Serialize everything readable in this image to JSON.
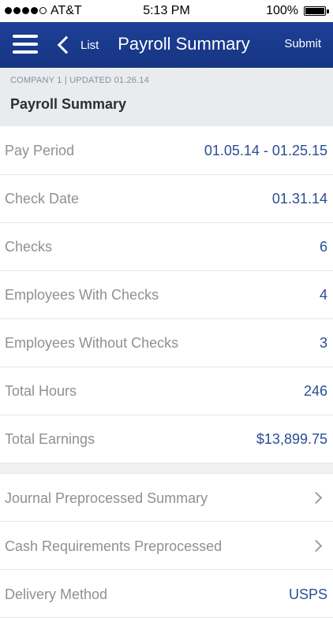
{
  "status_bar": {
    "carrier": "AT&T",
    "time": "5:13 PM",
    "battery": "100%",
    "battery_level": 1.0,
    "signal_bars": 4
  },
  "nav_bar": {
    "back_label": "List",
    "title": "Payroll Summary",
    "submit_label": "Submit",
    "color": "#1d3f96"
  },
  "header": {
    "company_line": "COMPANY 1 | UPDATED 01.26.14",
    "section_title": "Payroll Summary"
  },
  "summary": [
    {
      "label": "Pay Period",
      "value": "01.05.14 - 01.25.15"
    },
    {
      "label": "Check Date",
      "value": "01.31.14"
    },
    {
      "label": "Checks",
      "value": "6"
    },
    {
      "label": "Employees With Checks",
      "value": "4"
    },
    {
      "label": "Employees Without Checks",
      "value": "3"
    },
    {
      "label": "Total Hours",
      "value": "246"
    },
    {
      "label": "Total Earnings",
      "value": "$13,899.75"
    }
  ],
  "reports": [
    {
      "label": "Journal Preprocessed Summary"
    },
    {
      "label": "Cash Requirements Preprocessed"
    },
    {
      "label": "Delivery Method",
      "value": "USPS"
    }
  ],
  "icons": [
    "menu-icon",
    "back-chevron-icon",
    "chevron-right-icon"
  ]
}
